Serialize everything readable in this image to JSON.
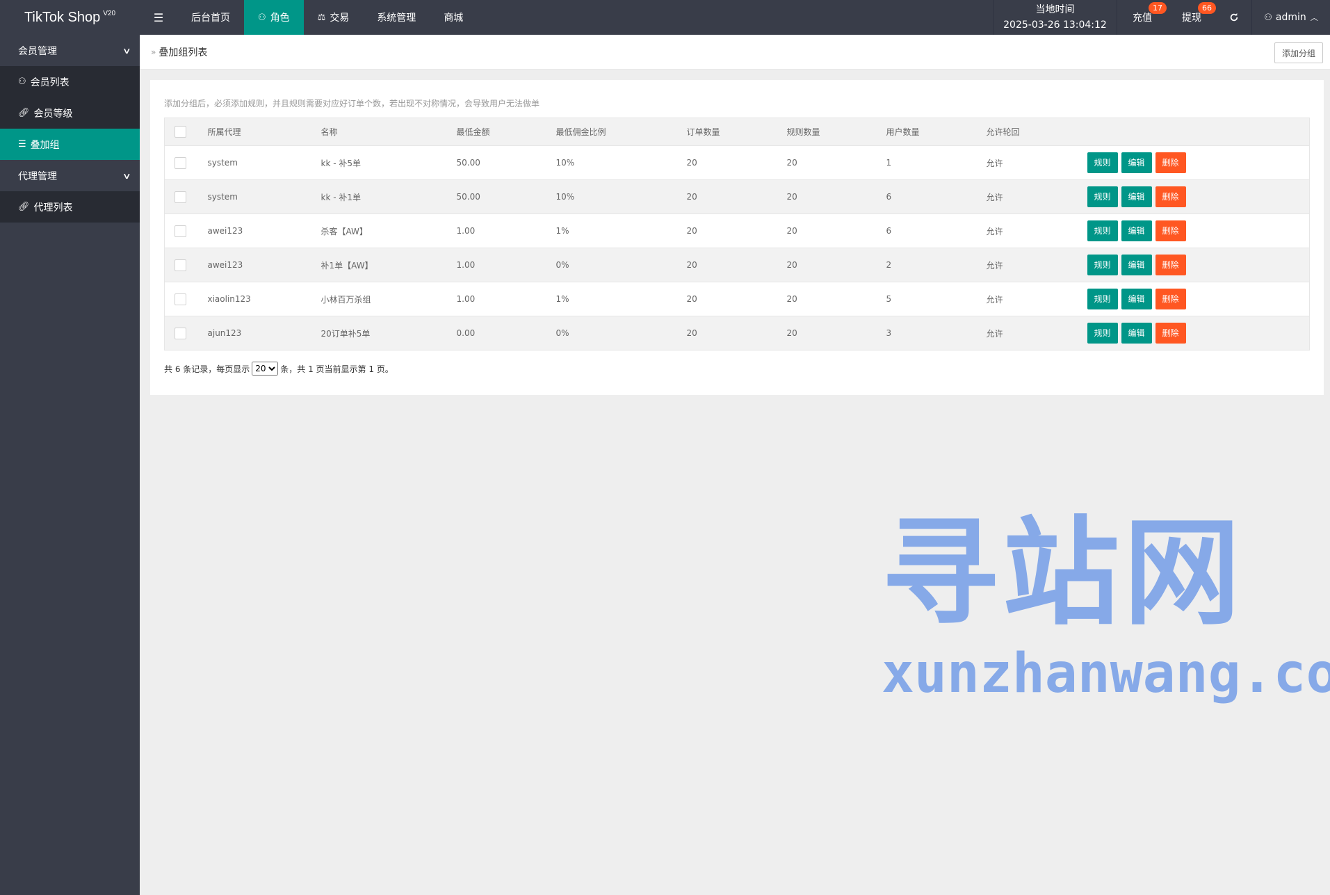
{
  "app": {
    "title": "TikTok Shop",
    "version": "V20"
  },
  "topnav": {
    "toggle_icon": "☰",
    "items": [
      {
        "label": "后台首页",
        "icon": "",
        "active": false
      },
      {
        "label": "角色",
        "icon": "user-icon",
        "active": true
      },
      {
        "label": "交易",
        "icon": "scale-icon",
        "active": false
      },
      {
        "label": "系统管理",
        "icon": "",
        "active": false
      },
      {
        "label": "商城",
        "icon": "",
        "active": false
      }
    ]
  },
  "topright": {
    "time_label": "当地时间",
    "time_value": "2025-03-26 13:04:12",
    "recharge_label": "充值",
    "recharge_badge": "17",
    "withdraw_label": "提现",
    "withdraw_badge": "66",
    "refresh_icon": "refresh-icon",
    "user_name": "admin"
  },
  "sidebar": {
    "groups": [
      {
        "label": "会员管理",
        "items": [
          {
            "label": "会员列表",
            "icon": "user-icon"
          },
          {
            "label": "会员等级",
            "icon": "link-icon"
          },
          {
            "label": "叠加组",
            "icon": "list-icon",
            "active": true
          }
        ]
      },
      {
        "label": "代理管理",
        "items": [
          {
            "label": "代理列表",
            "icon": "link-icon"
          }
        ]
      }
    ]
  },
  "breadcrumb": {
    "current": "叠加组列表"
  },
  "toolbar": {
    "add_group_label": "添加分组"
  },
  "notice": "添加分组后，必须添加规则，并且规则需要对应好订单个数，若出现不对称情况，会导致用户无法做单",
  "table": {
    "headers": [
      "所属代理",
      "名称",
      "最低金额",
      "最低佣金比例",
      "订单数量",
      "规则数量",
      "用户数量",
      "允许轮回"
    ],
    "action_labels": {
      "rule": "规则",
      "edit": "编辑",
      "delete": "删除"
    },
    "rows": [
      [
        "system",
        "kk - 补5单",
        "50.00",
        "10%",
        "20",
        "20",
        "1",
        "允许"
      ],
      [
        "system",
        "kk - 补1单",
        "50.00",
        "10%",
        "20",
        "20",
        "6",
        "允许"
      ],
      [
        "awei123",
        "杀客【AW】",
        "1.00",
        "1%",
        "20",
        "20",
        "6",
        "允许"
      ],
      [
        "awei123",
        "补1单【AW】",
        "1.00",
        "0%",
        "20",
        "20",
        "2",
        "允许"
      ],
      [
        "xiaolin123",
        "小林百万杀组",
        "1.00",
        "1%",
        "20",
        "20",
        "5",
        "允许"
      ],
      [
        "ajun123",
        "20订单补5单",
        "0.00",
        "0%",
        "20",
        "20",
        "3",
        "允许"
      ]
    ]
  },
  "pager": {
    "prefix": "共 6 条记录，每页显示",
    "page_size": "20",
    "suffix": "条，共 1 页当前显示第 1 页。"
  },
  "watermark": {
    "title": "寻站网",
    "url": "xunzhanwang.com"
  },
  "colors": {
    "topbar": "#393d49",
    "accent": "#009688",
    "danger": "#ff5722"
  }
}
